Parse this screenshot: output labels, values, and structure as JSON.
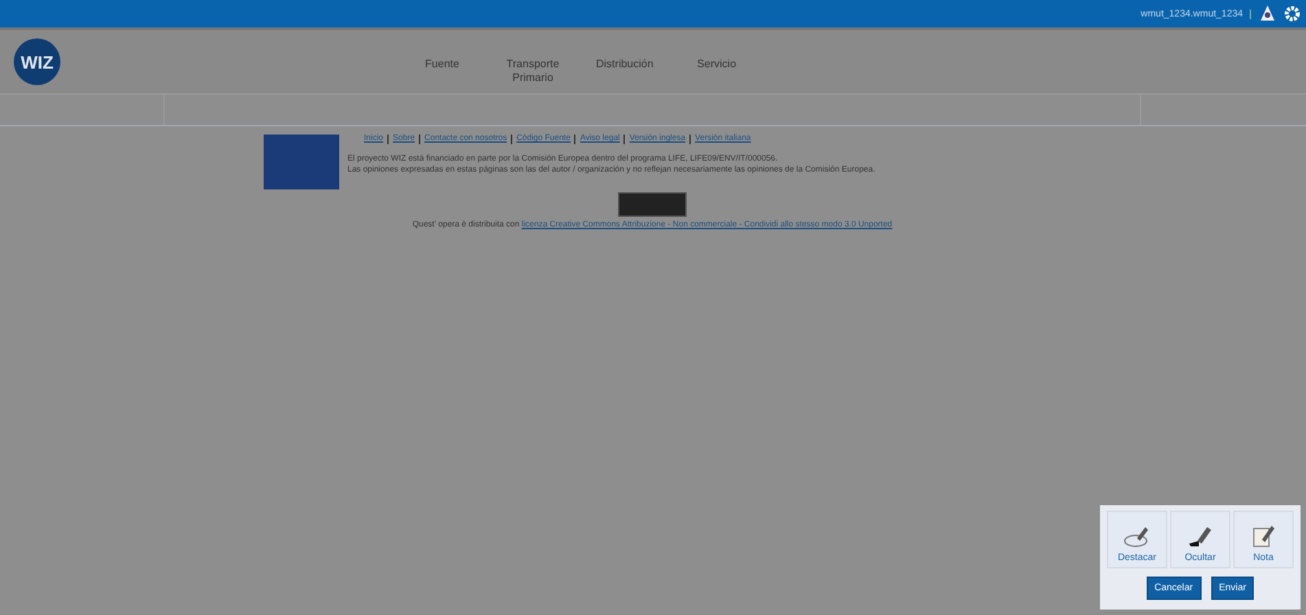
{
  "top_bar": {
    "user": "wmut_1234.wmut_1234"
  },
  "header": {
    "logo": "WIZ",
    "nav": [
      "Fuente",
      "Transporte Primario",
      "Distribución",
      "Servicio"
    ]
  },
  "footer": {
    "links": [
      "Inicio",
      "Sobre",
      "Contacte con nosotros",
      "Código Fuente",
      "Aviso legal",
      "Versión inglesa",
      "Versión italiana"
    ],
    "funding": "El proyecto WIZ está financiado en parte por la Comisión Europea dentro del programa LIFE, LIFE09/ENV/IT/000056.",
    "disclaimer": "Las opiniones expresadas en estas páginas son las del autor / organización y no reflejan necesariamente las opiniones de la Comisión Europea.",
    "license_prefix": "Quest' opera è distribuita con",
    "license_link": "licenza Creative Commons Attribuzione - Non commerciale - Condividi allo stesso modo 3.0 Unported"
  },
  "feedback": {
    "tools": [
      {
        "kind": "highlight",
        "label": "Destacar"
      },
      {
        "kind": "hide",
        "label": "Ocultar"
      },
      {
        "kind": "note",
        "label": "Nota"
      }
    ],
    "buttons": [
      "Cancelar",
      "Enviar"
    ]
  }
}
